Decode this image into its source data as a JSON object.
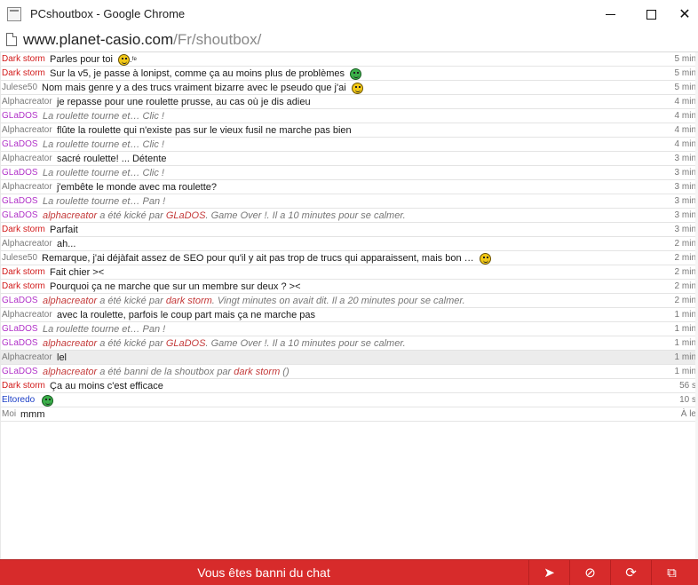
{
  "window": {
    "title": "PCshoutbox - Google Chrome",
    "min_icon": "minimize-icon",
    "max_icon": "maximize-icon",
    "close_icon": "close-icon",
    "close_glyph": "✕"
  },
  "address": {
    "host": "www.planet-casio.com",
    "path": "/Fr/shoutbox/"
  },
  "messages": [
    {
      "author": "Dark storm",
      "author_color": "#d21a1a",
      "parts": [
        {
          "text": "Parles pour toi "
        }
      ],
      "smiley": "yellow",
      "extra": ".ᶠᵉ",
      "time": "5 min"
    },
    {
      "author": "Dark storm",
      "author_color": "#d21a1a",
      "parts": [
        {
          "text": "Sur la v5, je passe à lonipst, comme ça au moins plus de problèmes "
        }
      ],
      "smiley": "green",
      "time": "5 min"
    },
    {
      "author": "Julese50",
      "author_color": "#7a7a7a",
      "parts": [
        {
          "text": "Nom mais genre y a des trucs vraiment bizarre avec le pseudo que j'ai "
        }
      ],
      "smiley": "yellow",
      "time": "5 min"
    },
    {
      "author": "Alphacreator",
      "author_color": "#7a7a7a",
      "parts": [
        {
          "text": "je repasse pour une roulette prusse, au cas où je dis adieu"
        }
      ],
      "time": "4 min"
    },
    {
      "author": "GLaDOS",
      "author_color": "#b132c8",
      "sys": true,
      "parts": [
        {
          "text": "La roulette tourne et… Clic !"
        }
      ],
      "time": "4 min"
    },
    {
      "author": "Alphacreator",
      "author_color": "#7a7a7a",
      "parts": [
        {
          "text": "flûte la roulette qui n'existe pas sur le vieux fusil ne marche pas bien"
        }
      ],
      "time": "4 min"
    },
    {
      "author": "GLaDOS",
      "author_color": "#b132c8",
      "sys": true,
      "parts": [
        {
          "text": "La roulette tourne et… Clic !"
        }
      ],
      "time": "4 min"
    },
    {
      "author": "Alphacreator",
      "author_color": "#7a7a7a",
      "parts": [
        {
          "text": "sacré roulette! ... Détente"
        }
      ],
      "time": "3 min"
    },
    {
      "author": "GLaDOS",
      "author_color": "#b132c8",
      "sys": true,
      "parts": [
        {
          "text": "La roulette tourne et… Clic !"
        }
      ],
      "time": "3 min"
    },
    {
      "author": "Alphacreator",
      "author_color": "#7a7a7a",
      "parts": [
        {
          "text": "j'embête le monde avec ma roulette?"
        }
      ],
      "time": "3 min"
    },
    {
      "author": "GLaDOS",
      "author_color": "#b132c8",
      "sys": true,
      "parts": [
        {
          "text": "La roulette tourne et… Pan !"
        }
      ],
      "time": "3 min"
    },
    {
      "author": "GLaDOS",
      "author_color": "#b132c8",
      "sys": true,
      "parts": [
        {
          "text": "alphacreator",
          "red": true
        },
        {
          "text": " a été kické par "
        },
        {
          "text": "GLaDOS",
          "red": true
        },
        {
          "text": ". Game Over !. Il a 10 minutes pour se calmer."
        }
      ],
      "time": "3 min"
    },
    {
      "author": "Dark storm",
      "author_color": "#d21a1a",
      "parts": [
        {
          "text": "Parfait"
        }
      ],
      "time": "3 min"
    },
    {
      "author": "Alphacreator",
      "author_color": "#7a7a7a",
      "parts": [
        {
          "text": "ah..."
        }
      ],
      "time": "2 min"
    },
    {
      "author": "Julese50",
      "author_color": "#7a7a7a",
      "parts": [
        {
          "text": "Remarque, j'ai déjàfait assez de SEO pour qu'il y ait pas trop de trucs qui apparaissent, mais bon … "
        }
      ],
      "smiley": "yellow",
      "time": "2 min"
    },
    {
      "author": "Dark storm",
      "author_color": "#d21a1a",
      "parts": [
        {
          "text": "Fait chier ><"
        }
      ],
      "time": "2 min"
    },
    {
      "author": "Dark storm",
      "author_color": "#d21a1a",
      "parts": [
        {
          "text": "Pourquoi ça ne marche que sur un membre sur deux ? ><"
        }
      ],
      "time": "2 min"
    },
    {
      "author": "GLaDOS",
      "author_color": "#b132c8",
      "sys": true,
      "parts": [
        {
          "text": "alphacreator",
          "red": true
        },
        {
          "text": " a été kické par "
        },
        {
          "text": "dark storm",
          "red": true
        },
        {
          "text": ". Vingt minutes on avait dit. Il a 20 minutes pour se calmer."
        }
      ],
      "time": "2 min"
    },
    {
      "author": "Alphacreator",
      "author_color": "#7a7a7a",
      "parts": [
        {
          "text": "avec la roulette, parfois le coup part mais ça ne marche pas"
        }
      ],
      "time": "1 min"
    },
    {
      "author": "GLaDOS",
      "author_color": "#b132c8",
      "sys": true,
      "parts": [
        {
          "text": "La roulette tourne et… Pan !"
        }
      ],
      "time": "1 min"
    },
    {
      "author": "GLaDOS",
      "author_color": "#b132c8",
      "sys": true,
      "parts": [
        {
          "text": "alphacreator",
          "red": true
        },
        {
          "text": " a été kické par "
        },
        {
          "text": "GLaDOS",
          "red": true
        },
        {
          "text": ". Game Over !. Il a 10 minutes pour se calmer."
        }
      ],
      "time": "1 min"
    },
    {
      "author": "Alphacreator",
      "author_color": "#7a7a7a",
      "parts": [
        {
          "text": "lel"
        }
      ],
      "time": "1 min",
      "highlight": true
    },
    {
      "author": "GLaDOS",
      "author_color": "#b132c8",
      "sys": true,
      "parts": [
        {
          "text": "alphacreator",
          "red": true
        },
        {
          "text": " a été banni de la shoutbox par "
        },
        {
          "text": "dark storm",
          "red": true
        },
        {
          "text": " ()"
        }
      ],
      "time": "1 min"
    },
    {
      "author": "Dark storm",
      "author_color": "#d21a1a",
      "parts": [
        {
          "text": "Ça au moins c'est efficace"
        }
      ],
      "time": "56 s"
    },
    {
      "author": "Eltoredo",
      "author_color": "#1c3fc7",
      "parts": [
        {
          "text": ""
        }
      ],
      "smiley": "green",
      "time": "10 s"
    },
    {
      "author": "Moi",
      "author_color": "#7a7a7a",
      "parts": [
        {
          "text": "mmm"
        }
      ],
      "time": "À le"
    }
  ],
  "bottom": {
    "banned_label": "Vous êtes banni du chat",
    "send_icon": "send-icon",
    "mute_icon": "mute-icon",
    "refresh_icon": "refresh-icon",
    "popout_icon": "popout-icon",
    "send_glyph": "➤",
    "mute_glyph": "⊘",
    "refresh_glyph": "⟳",
    "popout_glyph": "⧉"
  }
}
